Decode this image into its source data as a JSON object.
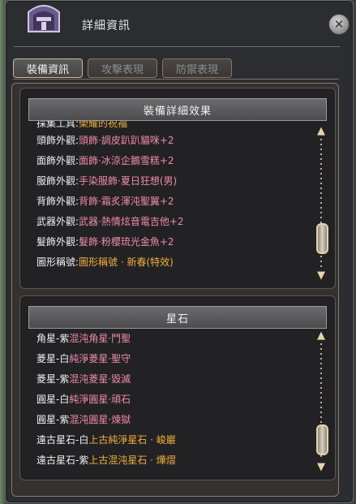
{
  "window": {
    "title": "詳細資訊",
    "close_label": "✕"
  },
  "tabs": [
    {
      "label": "裝備資訊",
      "active": true
    },
    {
      "label": "攻擊表現",
      "active": false
    },
    {
      "label": "防禦表現",
      "active": false
    }
  ],
  "section1": {
    "header": "裝備詳細效果",
    "rows": [
      {
        "label": "採集工具:",
        "value": "榮耀的祝福",
        "color": "orange"
      },
      {
        "label": "頭飾外觀:",
        "value": "頭飾·調皮趴趴貓咪+2",
        "color": "pink"
      },
      {
        "label": "面飾外觀:",
        "value": "面飾·冰涼企鵝雪糕+2",
        "color": "pink"
      },
      {
        "label": "服飾外觀:",
        "value": "手染服飾·夏日狂想(男)",
        "color": "pink"
      },
      {
        "label": "背飾外觀:",
        "value": "背飾·霜炙渾沌聖翼+2",
        "color": "pink"
      },
      {
        "label": "武器外觀:",
        "value": "武器·熱情炫音電吉他+2",
        "color": "pink"
      },
      {
        "label": "髮飾外觀:",
        "value": "髮飾·粉櫻琉光金魚+2",
        "color": "pink"
      },
      {
        "label": "圖形稱號:",
        "value": "圖形稱號 · 新春(特效)",
        "color": "orange"
      }
    ]
  },
  "section2": {
    "header": "星石",
    "rows": [
      {
        "label": "角星-紫",
        "value": "混沌角星·鬥聖",
        "color": "pink"
      },
      {
        "label": "菱星-白",
        "value": "純淨菱星·聖守",
        "color": "pink"
      },
      {
        "label": "菱星-紫",
        "value": "混沌菱星·毀滅",
        "color": "pink"
      },
      {
        "label": "圓星-白",
        "value": "純淨圓星·頑石",
        "color": "pink"
      },
      {
        "label": "圓星-紫",
        "value": "混沌圓星·煉獄",
        "color": "pink"
      },
      {
        "label": "遠古星石-白",
        "value": "上古純淨星石 · 峻巖",
        "color": "orange"
      },
      {
        "label": "遠古星石-紫",
        "value": "上古混沌星石 · 燁熠",
        "color": "orange"
      }
    ]
  },
  "icons": {
    "helmet": "helmet-icon",
    "close": "close-icon",
    "scroll_up": "arrow-up-icon",
    "scroll_down": "arrow-down-icon"
  },
  "colors": {
    "pink": "#f08ba5",
    "orange": "#f0ae3a",
    "text": "#f0f0f0"
  }
}
